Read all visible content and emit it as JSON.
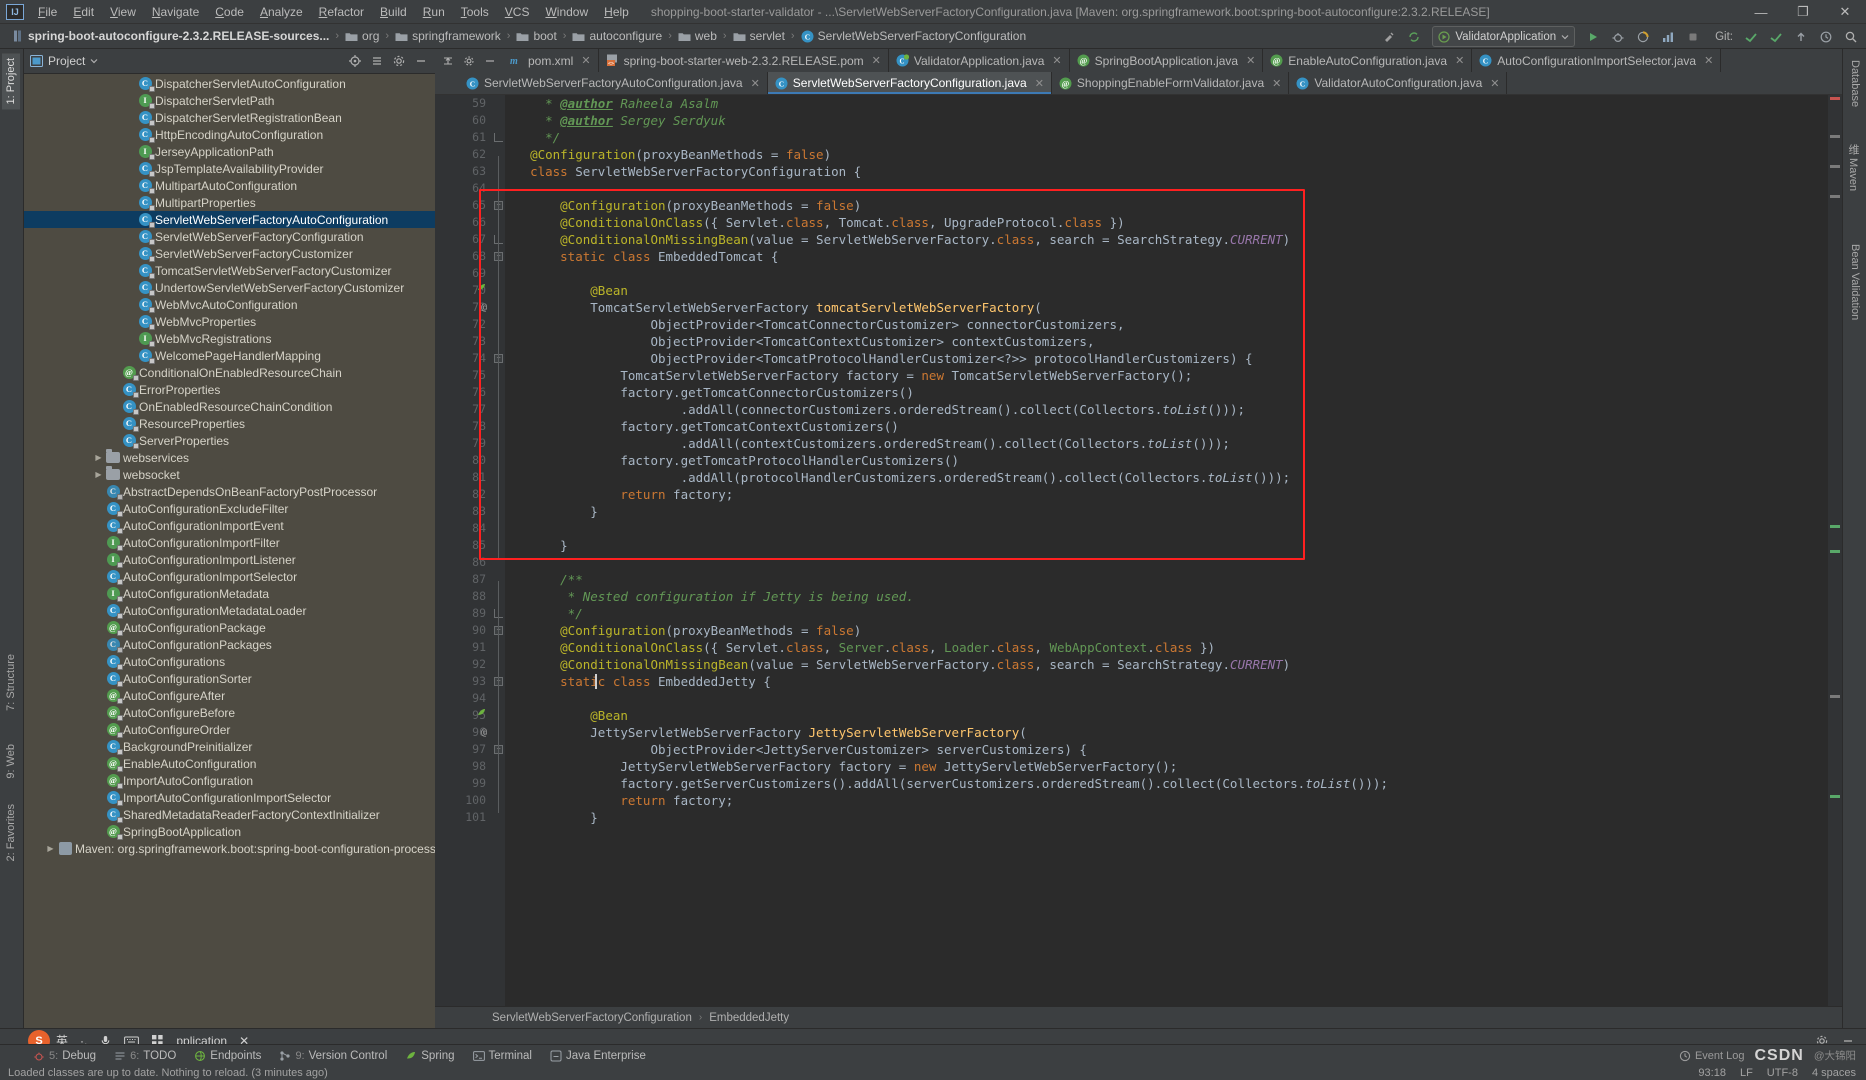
{
  "titlebar": {
    "logo": "IJ",
    "menus": [
      "File",
      "Edit",
      "View",
      "Navigate",
      "Code",
      "Analyze",
      "Refactor",
      "Build",
      "Run",
      "Tools",
      "VCS",
      "Window",
      "Help"
    ],
    "title": "shopping-boot-starter-validator - ...\\ServletWebServerFactoryConfiguration.java [Maven: org.springframework.boot:spring-boot-autoconfigure:2.3.2.RELEASE]",
    "minimize": "—",
    "maximize": "❐",
    "close": "✕"
  },
  "navbar": {
    "crumbs": [
      {
        "label": "spring-boot-autoconfigure-2.3.2.RELEASE-sources...",
        "icon": "module-icon"
      },
      {
        "label": "org",
        "icon": "folder-icon"
      },
      {
        "label": "springframework",
        "icon": "folder-icon"
      },
      {
        "label": "boot",
        "icon": "folder-icon"
      },
      {
        "label": "autoconfigure",
        "icon": "folder-icon"
      },
      {
        "label": "web",
        "icon": "folder-icon"
      },
      {
        "label": "servlet",
        "icon": "folder-icon"
      },
      {
        "label": "ServletWebServerFactoryConfiguration",
        "icon": "class-icon"
      }
    ],
    "run_config": "ValidatorApplication",
    "git_label": "Git:",
    "separator": "›"
  },
  "left_strip": {
    "tabs": [
      {
        "label": "1: Project",
        "active": true
      },
      {
        "label": "7: Structure",
        "active": false
      },
      {
        "label": "9: Web",
        "active": false
      },
      {
        "label": "2: Favorites",
        "active": false
      }
    ]
  },
  "right_strip": {
    "tabs": [
      "Database",
      "维 Maven",
      "Bean Validation"
    ]
  },
  "project_panel": {
    "title": "Project",
    "tree": [
      {
        "label": "DispatcherServletAutoConfiguration",
        "icon": "class-icon",
        "indent": 6,
        "twist": false
      },
      {
        "label": "DispatcherServletPath",
        "icon": "interface-icon",
        "indent": 6,
        "twist": false
      },
      {
        "label": "DispatcherServletRegistrationBean",
        "icon": "class-icon",
        "indent": 6,
        "twist": false
      },
      {
        "label": "HttpEncodingAutoConfiguration",
        "icon": "class-icon",
        "indent": 6,
        "twist": false
      },
      {
        "label": "JerseyApplicationPath",
        "icon": "interface-icon",
        "indent": 6,
        "twist": false
      },
      {
        "label": "JspTemplateAvailabilityProvider",
        "icon": "class-icon",
        "indent": 6,
        "twist": false
      },
      {
        "label": "MultipartAutoConfiguration",
        "icon": "class-icon",
        "indent": 6,
        "twist": false
      },
      {
        "label": "MultipartProperties",
        "icon": "class-icon",
        "indent": 6,
        "twist": false
      },
      {
        "label": "ServletWebServerFactoryAutoConfiguration",
        "icon": "class-icon",
        "indent": 6,
        "twist": false,
        "selected": true
      },
      {
        "label": "ServletWebServerFactoryConfiguration",
        "icon": "class-icon",
        "indent": 6,
        "twist": false
      },
      {
        "label": "ServletWebServerFactoryCustomizer",
        "icon": "class-icon",
        "indent": 6,
        "twist": false
      },
      {
        "label": "TomcatServletWebServerFactoryCustomizer",
        "icon": "class-icon",
        "indent": 6,
        "twist": false
      },
      {
        "label": "UndertowServletWebServerFactoryCustomizer",
        "icon": "class-icon",
        "indent": 6,
        "twist": false
      },
      {
        "label": "WebMvcAutoConfiguration",
        "icon": "class-icon",
        "indent": 6,
        "twist": false
      },
      {
        "label": "WebMvcProperties",
        "icon": "class-icon",
        "indent": 6,
        "twist": false
      },
      {
        "label": "WebMvcRegistrations",
        "icon": "interface-icon",
        "indent": 6,
        "twist": false
      },
      {
        "label": "WelcomePageHandlerMapping",
        "icon": "class-icon",
        "indent": 6,
        "twist": false
      },
      {
        "label": "ConditionalOnEnabledResourceChain",
        "icon": "annotation-icon",
        "indent": 5,
        "twist": false
      },
      {
        "label": "ErrorProperties",
        "icon": "class-icon",
        "indent": 5,
        "twist": false
      },
      {
        "label": "OnEnabledResourceChainCondition",
        "icon": "class-icon",
        "indent": 5,
        "twist": false
      },
      {
        "label": "ResourceProperties",
        "icon": "class-icon",
        "indent": 5,
        "twist": false
      },
      {
        "label": "ServerProperties",
        "icon": "class-icon",
        "indent": 5,
        "twist": false
      },
      {
        "label": "webservices",
        "icon": "folder-icon",
        "indent": 4,
        "twist": true
      },
      {
        "label": "websocket",
        "icon": "folder-icon",
        "indent": 4,
        "twist": true
      },
      {
        "label": "AbstractDependsOnBeanFactoryPostProcessor",
        "icon": "abstract-class-icon",
        "indent": 4,
        "twist": false
      },
      {
        "label": "AutoConfigurationExcludeFilter",
        "icon": "class-icon",
        "indent": 4,
        "twist": false
      },
      {
        "label": "AutoConfigurationImportEvent",
        "icon": "class-icon",
        "indent": 4,
        "twist": false
      },
      {
        "label": "AutoConfigurationImportFilter",
        "icon": "interface-icon",
        "indent": 4,
        "twist": false
      },
      {
        "label": "AutoConfigurationImportListener",
        "icon": "interface-icon",
        "indent": 4,
        "twist": false
      },
      {
        "label": "AutoConfigurationImportSelector",
        "icon": "class-icon",
        "indent": 4,
        "twist": false
      },
      {
        "label": "AutoConfigurationMetadata",
        "icon": "interface-icon",
        "indent": 4,
        "twist": false
      },
      {
        "label": "AutoConfigurationMetadataLoader",
        "icon": "class-icon",
        "indent": 4,
        "twist": false
      },
      {
        "label": "AutoConfigurationPackage",
        "icon": "annotation-icon",
        "indent": 4,
        "twist": false
      },
      {
        "label": "AutoConfigurationPackages",
        "icon": "abstract-class-icon",
        "indent": 4,
        "twist": false
      },
      {
        "label": "AutoConfigurations",
        "icon": "class-icon",
        "indent": 4,
        "twist": false
      },
      {
        "label": "AutoConfigurationSorter",
        "icon": "class-icon",
        "indent": 4,
        "twist": false
      },
      {
        "label": "AutoConfigureAfter",
        "icon": "annotation-icon",
        "indent": 4,
        "twist": false
      },
      {
        "label": "AutoConfigureBefore",
        "icon": "annotation-icon",
        "indent": 4,
        "twist": false
      },
      {
        "label": "AutoConfigureOrder",
        "icon": "annotation-icon",
        "indent": 4,
        "twist": false
      },
      {
        "label": "BackgroundPreinitializer",
        "icon": "class-icon",
        "indent": 4,
        "twist": false
      },
      {
        "label": "EnableAutoConfiguration",
        "icon": "annotation-icon",
        "indent": 4,
        "twist": false
      },
      {
        "label": "ImportAutoConfiguration",
        "icon": "annotation-icon",
        "indent": 4,
        "twist": false
      },
      {
        "label": "ImportAutoConfigurationImportSelector",
        "icon": "class-icon",
        "indent": 4,
        "twist": false
      },
      {
        "label": "SharedMetadataReaderFactoryContextInitializer",
        "icon": "class-icon",
        "indent": 4,
        "twist": false
      },
      {
        "label": "SpringBootApplication",
        "icon": "annotation-icon",
        "indent": 4,
        "twist": false
      },
      {
        "label": "Maven: org.springframework.boot:spring-boot-configuration-processor:",
        "icon": "maven-icon",
        "indent": 1,
        "twist": true
      }
    ]
  },
  "editor": {
    "tabs_row1": [
      {
        "label": "pom.xml",
        "icon": "maven-pom-icon",
        "active": false
      },
      {
        "label": "spring-boot-starter-web-2.3.2.RELEASE.pom",
        "icon": "xml-file-icon",
        "active": false
      },
      {
        "label": "ValidatorApplication.java",
        "icon": "spring-class-icon",
        "active": false
      },
      {
        "label": "SpringBootApplication.java",
        "icon": "annotation-icon",
        "active": false
      },
      {
        "label": "EnableAutoConfiguration.java",
        "icon": "annotation-icon",
        "active": false
      },
      {
        "label": "AutoConfigurationImportSelector.java",
        "icon": "class-icon",
        "active": false
      }
    ],
    "tabs_row2": [
      {
        "label": "ServletWebServerFactoryAutoConfiguration.java",
        "icon": "class-icon",
        "active": false
      },
      {
        "label": "ServletWebServerFactoryConfiguration.java",
        "icon": "class-icon",
        "active": true
      },
      {
        "label": "ShoppingEnableFormValidator.java",
        "icon": "annotation-icon",
        "active": false
      },
      {
        "label": "ValidatorAutoConfiguration.java",
        "icon": "class-icon",
        "active": false
      }
    ],
    "breadcrumb": [
      "ServletWebServerFactoryConfiguration",
      "EmbeddedJetty"
    ],
    "breadcrumb_sep": "›",
    "first_line_number": 59,
    "lines": [
      {
        "n": 59,
        "html": "   <span class='jdoc'> * </span><span class='jtag'>@author</span><span class='jdoc'> Raheela Asalm</span>"
      },
      {
        "n": 60,
        "html": "   <span class='jdoc'> * </span><span class='jtag'>@author</span><span class='jdoc'> Sergey Serdyuk</span>"
      },
      {
        "n": 61,
        "html": "   <span class='jdoc'> */</span>"
      },
      {
        "n": 62,
        "html": "  <span class='ann'>@Configuration</span><span class='def'>(</span><span class='def'>proxyBeanMethods </span><span class='def'>= </span><span class='kw'>false</span><span class='def'>)</span>"
      },
      {
        "n": 63,
        "html": "  <span class='kw'>class </span><span class='def'>ServletWebServerFactoryConfiguration {</span>"
      },
      {
        "n": 64,
        "html": ""
      },
      {
        "n": 65,
        "html": "      <span class='ann'>@Configuration</span><span class='def'>(</span><span class='def'>proxyBeanMethods </span><span class='def'>= </span><span class='kw'>false</span><span class='def'>)</span>"
      },
      {
        "n": 66,
        "html": "      <span class='ann'>@ConditionalOnClass</span><span class='def'>({ Servlet.</span><span class='kw'>class</span><span class='def'>, Tomcat.</span><span class='kw'>class</span><span class='def'>, UpgradeProtocol.</span><span class='kw'>class</span><span class='def'> })</span>"
      },
      {
        "n": 67,
        "html": "      <span class='ann'>@ConditionalOnMissingBean</span><span class='def'>(value = ServletWebServerFactory.</span><span class='kw'>class</span><span class='def'>, search = SearchStrategy.</span><span class='fld' style='font-style:italic'>CURRENT</span><span class='def'>)</span>"
      },
      {
        "n": 68,
        "html": "      <span class='kw'>static class </span><span class='def'>EmbeddedTomcat {</span>"
      },
      {
        "n": 69,
        "html": ""
      },
      {
        "n": 70,
        "html": "          <span class='ann'>@Bean</span>",
        "run_marker": true
      },
      {
        "n": 71,
        "html": "          <span class='def'>TomcatServletWebServerFactory </span><span class='mth'>tomcatServletWebServerFactory</span><span class='def'>(</span>",
        "at_marker": true
      },
      {
        "n": 72,
        "html": "                  <span class='def'>ObjectProvider&lt;TomcatConnectorCustomizer&gt; connectorCustomizers,</span>"
      },
      {
        "n": 73,
        "html": "                  <span class='def'>ObjectProvider&lt;TomcatContextCustomizer&gt; contextCustomizers,</span>"
      },
      {
        "n": 74,
        "html": "                  <span class='def'>ObjectProvider&lt;TomcatProtocolHandlerCustomizer&lt;?&gt;&gt; protocolHandlerCustomizers) {</span>"
      },
      {
        "n": 75,
        "html": "              <span class='def'>TomcatServletWebServerFactory factory = </span><span class='kw'>new </span><span class='def'>TomcatServletWebServerFactory();</span>"
      },
      {
        "n": 76,
        "html": "              <span class='def'>factory.getTomcatConnectorCustomizers()</span>"
      },
      {
        "n": 77,
        "html": "                      <span class='def'>.addAll(connectorCustomizers.orderedStream().collect(Collectors.</span><span class='stat' style='font-style:italic'>toList</span><span class='def'>()));</span>"
      },
      {
        "n": 78,
        "html": "              <span class='def'>factory.getTomcatContextCustomizers()</span>"
      },
      {
        "n": 79,
        "html": "                      <span class='def'>.addAll(contextCustomizers.orderedStream().collect(Collectors.</span><span class='stat' style='font-style:italic'>toList</span><span class='def'>()));</span>"
      },
      {
        "n": 80,
        "html": "              <span class='def'>factory.getTomcatProtocolHandlerCustomizers()</span>"
      },
      {
        "n": 81,
        "html": "                      <span class='def'>.addAll(protocolHandlerCustomizers.orderedStream().collect(Collectors.</span><span class='stat' style='font-style:italic'>toList</span><span class='def'>()));</span>"
      },
      {
        "n": 82,
        "html": "              <span class='kw'>return </span><span class='def'>factory;</span>"
      },
      {
        "n": 83,
        "html": "          <span class='def'>}</span>"
      },
      {
        "n": 84,
        "html": ""
      },
      {
        "n": 85,
        "html": "      <span class='def'>}</span>"
      },
      {
        "n": 86,
        "html": ""
      },
      {
        "n": 87,
        "html": "      <span class='jdoc'>/**</span>"
      },
      {
        "n": 88,
        "html": "      <span class='jdoc'> * Nested configuration if Jetty is being used.</span>"
      },
      {
        "n": 89,
        "html": "      <span class='jdoc'> */</span>"
      },
      {
        "n": 90,
        "html": "      <span class='ann'>@Configuration</span><span class='def'>(</span><span class='def'>proxyBeanMethods </span><span class='def'>= </span><span class='kw'>false</span><span class='def'>)</span>"
      },
      {
        "n": 91,
        "html": "      <span class='ann'>@ConditionalOnClass</span><span class='def'>({ Servlet.</span><span class='kw'>class</span><span class='def'>, </span><span class='jdoc' style='font-style:normal'>Server</span><span class='def'>.</span><span class='kw'>class</span><span class='def'>, </span><span class='jdoc' style='font-style:normal'>Loader</span><span class='def'>.</span><span class='kw'>class</span><span class='def'>, </span><span class='jdoc' style='font-style:normal'>WebAppContext</span><span class='def'>.</span><span class='kw'>class</span><span class='def'> })</span>"
      },
      {
        "n": 92,
        "html": "      <span class='ann'>@ConditionalOnMissingBean</span><span class='def'>(value = ServletWebServerFactory.</span><span class='kw'>class</span><span class='def'>, search = SearchStrategy.</span><span class='fld' style='font-style:italic'>CURRENT</span><span class='def'>)</span>"
      },
      {
        "n": 93,
        "html": "      <span class='kw'>static class </span><span class='def'>EmbeddedJetty {</span>"
      },
      {
        "n": 94,
        "html": ""
      },
      {
        "n": 95,
        "html": "          <span class='ann'>@Bean</span>",
        "run_marker": true
      },
      {
        "n": 96,
        "html": "          <span class='def'>JettyServletWebServerFactory </span><span class='mth'>JettyServletWebServerFactory</span><span class='def'>(</span>",
        "at_marker": true
      },
      {
        "n": 97,
        "html": "                  <span class='def'>ObjectProvider&lt;JettyServerCustomizer&gt; serverCustomizers) {</span>"
      },
      {
        "n": 98,
        "html": "              <span class='def'>JettyServletWebServerFactory factory = </span><span class='kw'>new </span><span class='def'>JettyServletWebServerFactory();</span>"
      },
      {
        "n": 99,
        "html": "              <span class='def'>factory.getServerCustomizers().addAll(serverCustomizers.orderedStream().collect(Collectors.</span><span class='stat' style='font-style:italic'>toList</span><span class='def'>()));</span>"
      },
      {
        "n": 100,
        "html": "              <span class='kw'>return </span><span class='def'>factory;</span>"
      },
      {
        "n": 101,
        "html": "          <span class='def'>}</span>"
      }
    ]
  },
  "bottom_bar": {
    "buttons": [
      {
        "num": "5:",
        "label": "Debug",
        "icon": "debug-icon"
      },
      {
        "num": "6:",
        "label": "TODO",
        "icon": "todo-icon"
      },
      {
        "num": "",
        "label": "Endpoints",
        "icon": "endpoints-icon"
      },
      {
        "num": "9:",
        "label": "Version Control",
        "icon": "vcs-icon"
      },
      {
        "num": "",
        "label": "Spring",
        "icon": "spring-icon"
      },
      {
        "num": "",
        "label": "Terminal",
        "icon": "terminal-icon"
      },
      {
        "num": "",
        "label": "Java Enterprise",
        "icon": "java-ee-icon"
      }
    ],
    "watermark": "CSDN",
    "watermark_sub": "@大锦阳",
    "event_log": "Event Log"
  },
  "ime_bar": {
    "logo": "S",
    "items": [
      "英",
      "·,",
      "mic-icon",
      "keyboard-icon",
      "apps-icon"
    ],
    "app_label": "pplication",
    "close": "✕"
  },
  "statusbar": {
    "message": "Loaded classes are up to date. Nothing to reload. (3 minutes ago)",
    "position": "93:18",
    "line_sep": "LF",
    "encoding": "UTF-8",
    "indent": "4 spaces"
  },
  "colors": {
    "accent": "#3d7ab5",
    "selection": "#0d3c61",
    "tree_bg": "#4e4b42",
    "editor_bg": "#2b2b2b",
    "chrome": "#3c3f41",
    "highlight_box": "#ff2020"
  }
}
